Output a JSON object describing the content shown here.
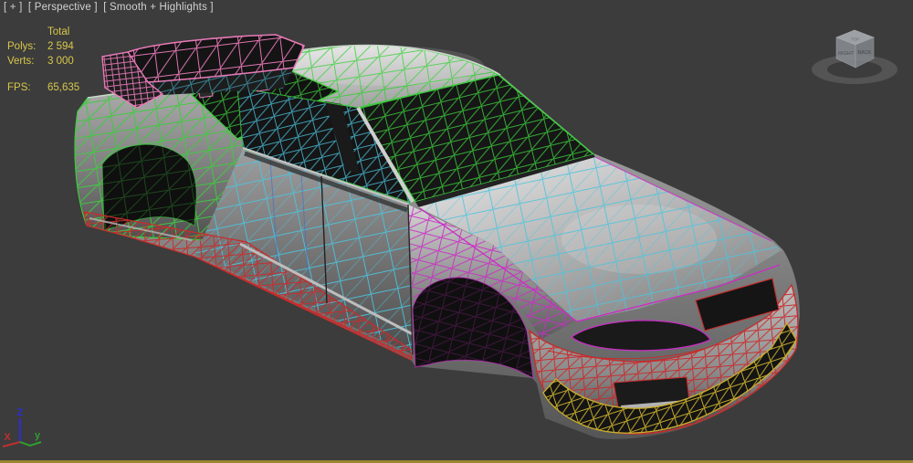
{
  "viewport": {
    "general": "[ + ]",
    "pov": "[ Perspective ]",
    "shading": "[ Smooth + Highlights ]"
  },
  "statistics": {
    "header": "Total",
    "rows": [
      {
        "label": "Polys:",
        "value": "2 594"
      },
      {
        "label": "Verts:",
        "value": "3 000"
      }
    ],
    "fps_label": "FPS:",
    "fps_value": "65,635",
    "text_color": "#d9c74a"
  },
  "viewcube": {
    "top": "TOP",
    "left": "RIGHT",
    "right": "BACK"
  },
  "axis": {
    "x_label": "X",
    "y_label": "y",
    "z_label": "Z",
    "x_color": "#c03030",
    "y_color": "#2f9e2f",
    "z_color": "#2c2cd8"
  },
  "canvas": {
    "background": "#3c3c3c",
    "active_viewport_border": "#97852f",
    "wire_colors": {
      "rear_roof_glass": "#3ecb3e",
      "doors_hood": "#4cc4de",
      "fender": "#cb2dc6",
      "spoiler": "#e87ab8",
      "bumper_rocker": "#c92b2b",
      "splitter": "#c9ae2c"
    }
  }
}
